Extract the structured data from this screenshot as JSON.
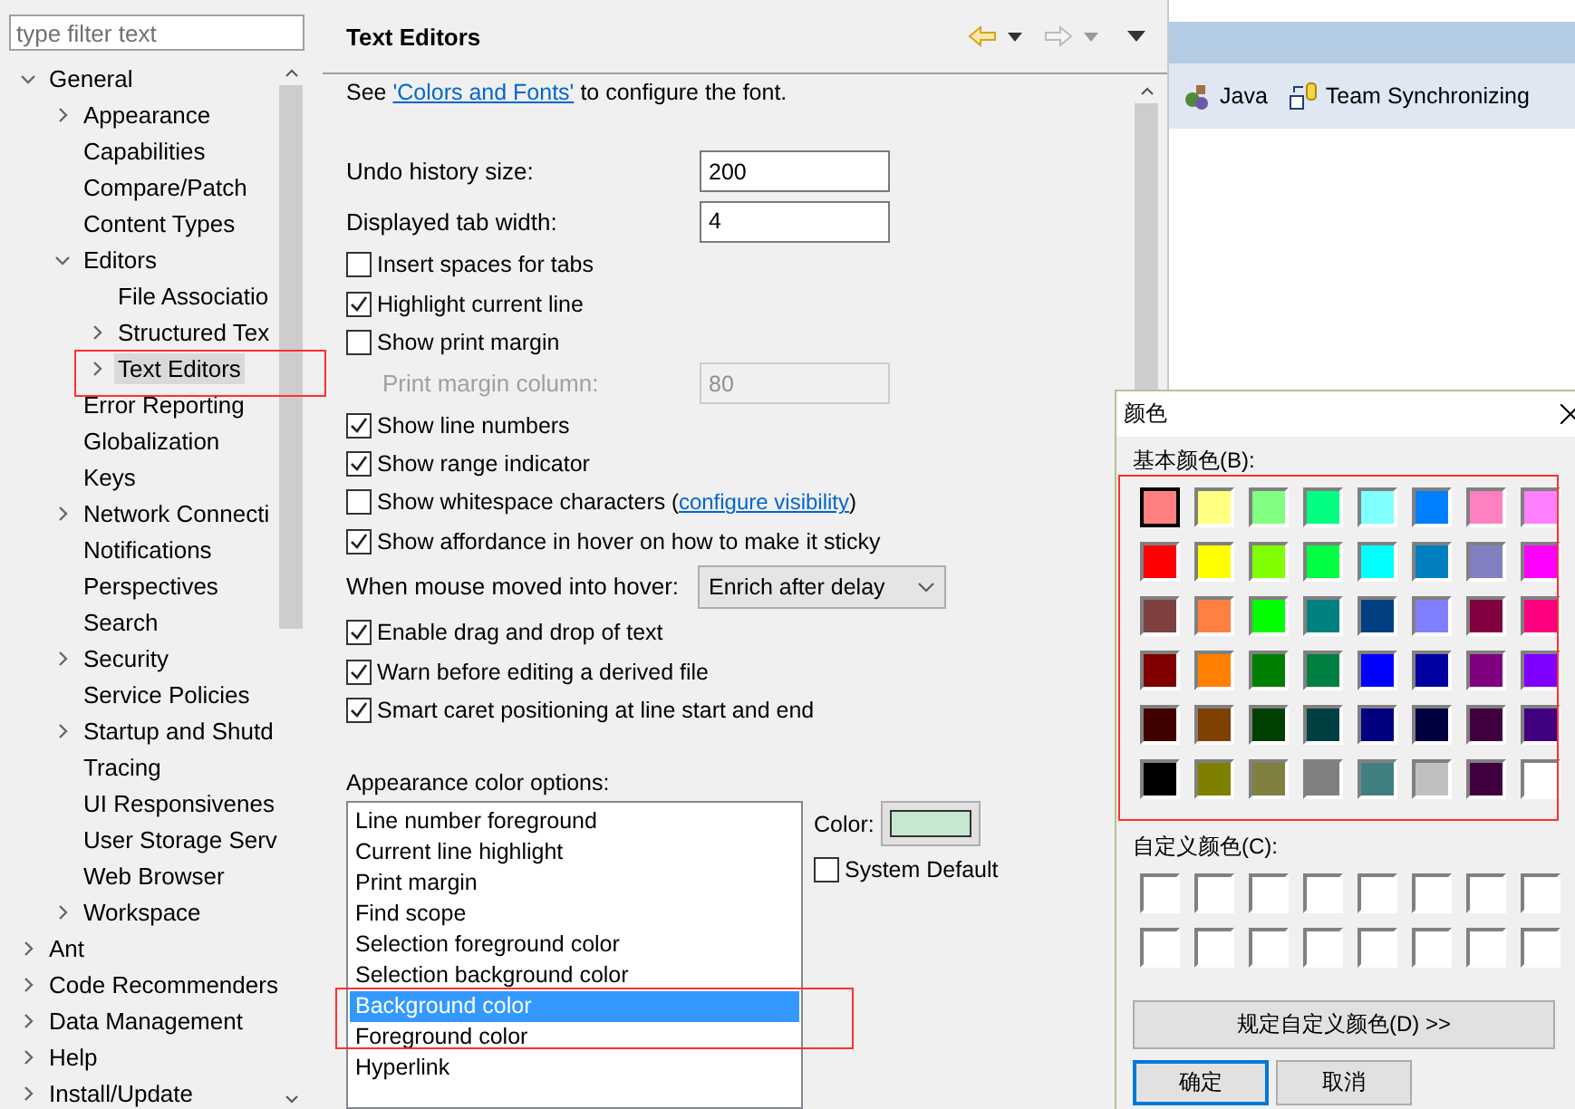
{
  "filter": {
    "placeholder": "type filter text"
  },
  "tree": [
    {
      "label": "General",
      "kind": "branch",
      "expanded": true,
      "selected": false,
      "children": [
        {
          "label": "Appearance",
          "kind": "branch",
          "expanded": false,
          "selected": false
        },
        {
          "label": "Capabilities",
          "kind": "leaf",
          "selected": false
        },
        {
          "label": "Compare/Patch",
          "kind": "leaf",
          "selected": false
        },
        {
          "label": "Content Types",
          "kind": "leaf",
          "selected": false
        },
        {
          "label": "Editors",
          "kind": "branch",
          "expanded": true,
          "selected": false,
          "children": [
            {
              "label": "File Associatio",
              "kind": "leaf",
              "selected": false
            },
            {
              "label": "Structured Tex",
              "kind": "branch",
              "expanded": false,
              "selected": false
            },
            {
              "label": "Text Editors",
              "kind": "branch",
              "expanded": false,
              "selected": true
            }
          ]
        },
        {
          "label": "Error Reporting",
          "kind": "leaf",
          "selected": false
        },
        {
          "label": "Globalization",
          "kind": "leaf",
          "selected": false
        },
        {
          "label": "Keys",
          "kind": "leaf",
          "selected": false
        },
        {
          "label": "Network Connecti",
          "kind": "branch",
          "expanded": false,
          "selected": false
        },
        {
          "label": "Notifications",
          "kind": "leaf",
          "selected": false
        },
        {
          "label": "Perspectives",
          "kind": "leaf",
          "selected": false
        },
        {
          "label": "Search",
          "kind": "leaf",
          "selected": false
        },
        {
          "label": "Security",
          "kind": "branch",
          "expanded": false,
          "selected": false
        },
        {
          "label": "Service Policies",
          "kind": "leaf",
          "selected": false
        },
        {
          "label": "Startup and Shutd",
          "kind": "branch",
          "expanded": false,
          "selected": false
        },
        {
          "label": "Tracing",
          "kind": "leaf",
          "selected": false
        },
        {
          "label": "UI Responsivenes",
          "kind": "leaf",
          "selected": false
        },
        {
          "label": "User Storage Serv",
          "kind": "leaf",
          "selected": false
        },
        {
          "label": "Web Browser",
          "kind": "leaf",
          "selected": false
        },
        {
          "label": "Workspace",
          "kind": "branch",
          "expanded": false,
          "selected": false
        }
      ]
    },
    {
      "label": "Ant",
      "kind": "branch",
      "expanded": false,
      "selected": false
    },
    {
      "label": "Code Recommenders",
      "kind": "branch",
      "expanded": false,
      "selected": false
    },
    {
      "label": "Data Management",
      "kind": "branch",
      "expanded": false,
      "selected": false
    },
    {
      "label": "Help",
      "kind": "branch",
      "expanded": false,
      "selected": false
    },
    {
      "label": "Install/Update",
      "kind": "branch",
      "expanded": false,
      "selected": false
    }
  ],
  "page": {
    "title": "Text Editors",
    "intro": {
      "before": "See",
      "link": "'Colors and Fonts'",
      "after": "to configure the font."
    },
    "settings": [
      {
        "kind": "number",
        "label": "Undo history size:",
        "value": "200",
        "disabled": false
      },
      {
        "kind": "number",
        "label": "Displayed tab width:",
        "value": "4",
        "disabled": false
      },
      {
        "kind": "checkbox",
        "label": "Insert spaces for tabs",
        "checked": false
      },
      {
        "kind": "checkbox",
        "label": "Highlight current line",
        "checked": true
      },
      {
        "kind": "checkbox",
        "label": "Show print margin",
        "checked": false
      },
      {
        "kind": "number",
        "label": "Print margin column:",
        "value": "80",
        "disabled": true
      },
      {
        "kind": "checkbox",
        "label": "Show line numbers",
        "checked": true
      },
      {
        "kind": "checkbox",
        "label": "Show range indicator",
        "checked": true
      },
      {
        "kind": "checkbox",
        "label": "Show whitespace characters",
        "checked": false,
        "link_open": "(",
        "link": "configure visibility",
        "link_close": ")"
      },
      {
        "kind": "checkbox",
        "label": "Show affordance in hover on how to make it sticky",
        "checked": true
      },
      {
        "kind": "select",
        "label": "When mouse moved into hover:",
        "value": "Enrich after delay"
      },
      {
        "kind": "checkbox",
        "label": "Enable drag and drop of text",
        "checked": true
      },
      {
        "kind": "checkbox",
        "label": "Warn before editing a derived file",
        "checked": true
      },
      {
        "kind": "checkbox",
        "label": "Smart caret positioning at line start and end",
        "checked": true
      }
    ],
    "appearance": {
      "label": "Appearance color options:",
      "items": [
        {
          "label": "Line number foreground",
          "selected": false
        },
        {
          "label": "Current line highlight",
          "selected": false
        },
        {
          "label": "Print margin",
          "selected": false
        },
        {
          "label": "Find scope",
          "selected": false
        },
        {
          "label": "Selection foreground color",
          "selected": false
        },
        {
          "label": "Selection background color",
          "selected": false
        },
        {
          "label": "Background color",
          "selected": true
        },
        {
          "label": "Foreground color",
          "selected": false
        },
        {
          "label": "Hyperlink",
          "selected": false
        }
      ],
      "color_label": "Color:",
      "color": "#c7e7d0",
      "system_default": {
        "label": "System Default",
        "checked": false
      }
    }
  },
  "perspectives": [
    {
      "label": "Java"
    },
    {
      "label": "Team Synchronizing"
    }
  ],
  "color_dialog": {
    "title": "颜色",
    "basic_label": "基本颜色(B):",
    "basic_colors": [
      {
        "color": "#ff8080",
        "selected": true
      },
      {
        "color": "#ffff80",
        "selected": false
      },
      {
        "color": "#80ff80",
        "selected": false
      },
      {
        "color": "#00ff80",
        "selected": false
      },
      {
        "color": "#80ffff",
        "selected": false
      },
      {
        "color": "#0080ff",
        "selected": false
      },
      {
        "color": "#ff80c0",
        "selected": false
      },
      {
        "color": "#ff80ff",
        "selected": false
      },
      {
        "color": "#ff0000",
        "selected": false
      },
      {
        "color": "#ffff00",
        "selected": false
      },
      {
        "color": "#80ff00",
        "selected": false
      },
      {
        "color": "#00ff40",
        "selected": false
      },
      {
        "color": "#00ffff",
        "selected": false
      },
      {
        "color": "#0080c0",
        "selected": false
      },
      {
        "color": "#8080c0",
        "selected": false
      },
      {
        "color": "#ff00ff",
        "selected": false
      },
      {
        "color": "#804040",
        "selected": false
      },
      {
        "color": "#ff8040",
        "selected": false
      },
      {
        "color": "#00ff00",
        "selected": false
      },
      {
        "color": "#008080",
        "selected": false
      },
      {
        "color": "#004080",
        "selected": false
      },
      {
        "color": "#8080ff",
        "selected": false
      },
      {
        "color": "#800040",
        "selected": false
      },
      {
        "color": "#ff0080",
        "selected": false
      },
      {
        "color": "#800000",
        "selected": false
      },
      {
        "color": "#ff8000",
        "selected": false
      },
      {
        "color": "#008000",
        "selected": false
      },
      {
        "color": "#008040",
        "selected": false
      },
      {
        "color": "#0000ff",
        "selected": false
      },
      {
        "color": "#0000a0",
        "selected": false
      },
      {
        "color": "#800080",
        "selected": false
      },
      {
        "color": "#8000ff",
        "selected": false
      },
      {
        "color": "#400000",
        "selected": false
      },
      {
        "color": "#804000",
        "selected": false
      },
      {
        "color": "#004000",
        "selected": false
      },
      {
        "color": "#004040",
        "selected": false
      },
      {
        "color": "#000080",
        "selected": false
      },
      {
        "color": "#000040",
        "selected": false
      },
      {
        "color": "#400040",
        "selected": false
      },
      {
        "color": "#400080",
        "selected": false
      },
      {
        "color": "#000000",
        "selected": false
      },
      {
        "color": "#808000",
        "selected": false
      },
      {
        "color": "#808040",
        "selected": false
      },
      {
        "color": "#808080",
        "selected": false
      },
      {
        "color": "#408080",
        "selected": false
      },
      {
        "color": "#c0c0c0",
        "selected": false
      },
      {
        "color": "#400040",
        "selected": false
      },
      {
        "color": "#ffffff",
        "selected": false
      }
    ],
    "custom_label": "自定义颜色(C):",
    "custom_colors": [
      {
        "color": "#ffffff"
      },
      {
        "color": "#ffffff"
      },
      {
        "color": "#ffffff"
      },
      {
        "color": "#ffffff"
      },
      {
        "color": "#ffffff"
      },
      {
        "color": "#ffffff"
      },
      {
        "color": "#ffffff"
      },
      {
        "color": "#ffffff"
      },
      {
        "color": "#ffffff"
      },
      {
        "color": "#ffffff"
      },
      {
        "color": "#ffffff"
      },
      {
        "color": "#ffffff"
      },
      {
        "color": "#ffffff"
      },
      {
        "color": "#ffffff"
      },
      {
        "color": "#ffffff"
      },
      {
        "color": "#ffffff"
      }
    ],
    "define_button": "规定自定义颜色(D) >>",
    "buttons": [
      {
        "label": "确定",
        "default": true
      },
      {
        "label": "取消",
        "default": false
      }
    ]
  }
}
